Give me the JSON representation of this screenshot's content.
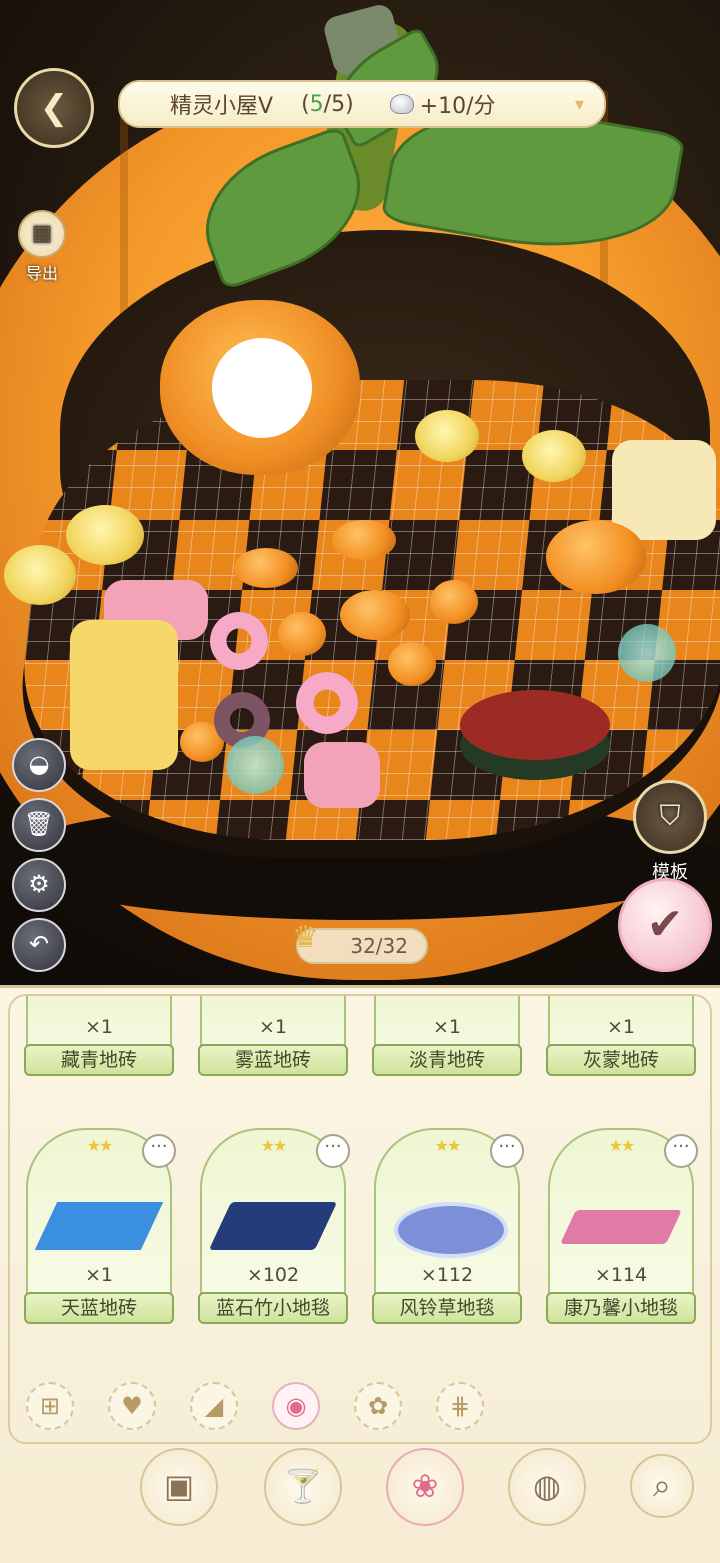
{
  "header": {
    "back_icon": "wings-back-icon",
    "house_name": "精灵小屋V",
    "open_paren": "(",
    "count_current": "5",
    "count_total": "/5)",
    "currency_icon": "shell-icon",
    "income_rate": "+10/分"
  },
  "left_tools": {
    "export_label": "导出",
    "buttons": [
      "hide-ui-icon",
      "trash-icon",
      "gear-icon",
      "undo-icon"
    ]
  },
  "right_tools": {
    "template_label": "模板",
    "confirm_icon": "check-icon"
  },
  "capacity": {
    "text": "32/32"
  },
  "items_top_row": [
    {
      "qty": "×1",
      "name": "藏青地砖"
    },
    {
      "qty": "×1",
      "name": "雾蓝地砖"
    },
    {
      "qty": "×1",
      "name": "淡青地砖"
    },
    {
      "qty": "×1",
      "name": "灰蒙地砖"
    }
  ],
  "items": [
    {
      "stars": "★★",
      "more": "···",
      "qty": "×1",
      "name": "天蓝地砖",
      "color": "#3b8fe0"
    },
    {
      "stars": "★★",
      "more": "···",
      "qty": "×102",
      "name": "蓝石竹小地毯",
      "color": "#243d7a"
    },
    {
      "stars": "★★",
      "more": "···",
      "qty": "×112",
      "name": "风铃草地毯",
      "color": "#7d8fd6"
    },
    {
      "stars": "★★",
      "more": "···",
      "qty": "×114",
      "name": "康乃馨小地毯",
      "color": "#e07aa6"
    }
  ],
  "categories": [
    {
      "icon": "floor-tile-icon",
      "glyph": "⊞"
    },
    {
      "icon": "watering-can-icon",
      "glyph": "♥"
    },
    {
      "icon": "cake-slice-icon",
      "glyph": "◢"
    },
    {
      "icon": "rug-icon",
      "glyph": "◉",
      "active": true
    },
    {
      "icon": "plant-icon",
      "glyph": "✿"
    },
    {
      "icon": "fence-icon",
      "glyph": "⋕"
    }
  ],
  "bottom_nav": [
    {
      "icon": "furniture-icon",
      "glyph": "▣"
    },
    {
      "icon": "cocktail-icon",
      "glyph": "🍸"
    },
    {
      "icon": "flower-vase-icon",
      "glyph": "❀",
      "active": true
    },
    {
      "icon": "planet-icon",
      "glyph": "◍"
    },
    {
      "icon": "search-icon",
      "glyph": "⌕"
    }
  ]
}
